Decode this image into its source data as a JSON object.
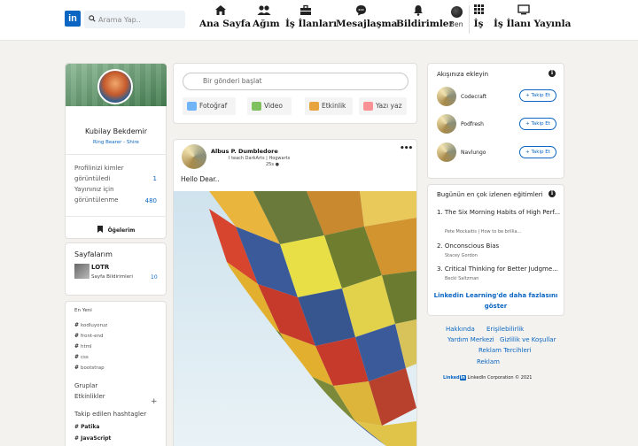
{
  "header": {
    "logo": "in",
    "search_placeholder": "Arama Yap..",
    "nav": [
      {
        "label": "Ana Sayfa",
        "icon": "home-icon"
      },
      {
        "label": "Ağım",
        "icon": "network-icon"
      },
      {
        "label": "İş İlanları",
        "icon": "briefcase-icon"
      },
      {
        "label": "Mesajlaşma",
        "icon": "message-icon"
      },
      {
        "label": "Bildirimler",
        "icon": "bell-icon"
      }
    ],
    "me_label": "Ben",
    "work_label": "İş",
    "post_job_label": "İş İlanı Yayınla"
  },
  "profile": {
    "name": "Kubilay Bekdemir",
    "headline": "Ring Bearer - Shire",
    "stats": [
      {
        "label": "Profilinizi kimler görüntüledi",
        "value": "1"
      },
      {
        "label": "Yayınınız için görüntülenme",
        "value": "480"
      }
    ],
    "items_label": "Öğelerim"
  },
  "pages": {
    "title": "Sayfalarım",
    "name": "LOTR",
    "subtitle": "Sayfa Bildirimleri",
    "count": "10"
  },
  "recent": {
    "title": "En Yeni",
    "tags": [
      "kodluyoruz",
      "front-end",
      "html",
      "css",
      "bootstrap"
    ],
    "groups_label": "Gruplar",
    "events_label": "Etkinlikler",
    "followed_title": "Takip edilen hashtagler",
    "followed_tags": [
      "Patika",
      "JavaScript"
    ]
  },
  "composer": {
    "placeholder": "Bir gönderi başlat",
    "actions": [
      {
        "label": "Fotoğraf",
        "color": "#70b5f9"
      },
      {
        "label": "Video",
        "color": "#7fc15e"
      },
      {
        "label": "Etkinlik",
        "color": "#e7a33e"
      },
      {
        "label": "Yazı yaz",
        "color": "#fc9295"
      }
    ]
  },
  "post": {
    "author": "Albus P. Dumbledore",
    "bio": "I teach DarkArts | Hogwarts",
    "time": "25s",
    "text": "Hello Dear.."
  },
  "feed_suggestions": {
    "title": "Akışınıza ekleyin",
    "follow_label": "+ Takip Et",
    "items": [
      "Codecraft",
      "Podfresh",
      "Navlungo"
    ]
  },
  "courses": {
    "title": "Bugünün en çok izlenen eğitimleri",
    "items": [
      {
        "title": "1. The Six Morning Habits of High Perf...",
        "sub": "Pete Mockaitis | How to be brillia..."
      },
      {
        "title": "2. Onconscious Bias",
        "sub": "Stacey Gordon"
      },
      {
        "title": "3. Critical Thinking for Better Judgme...",
        "sub": "Becki Saltzman"
      }
    ],
    "more": "Linkedin Learning'de daha fazlasını göster"
  },
  "footer": {
    "links": [
      "Hakkında",
      "Erişilebilirlik",
      "Yardım Merkezi",
      "Gizlilik ve Koşullar",
      "Reklam Tercihleri",
      "Reklam"
    ],
    "brand": "Linked",
    "brand_in": "in",
    "copyright": "LinkedIn Corporation © 2021"
  }
}
